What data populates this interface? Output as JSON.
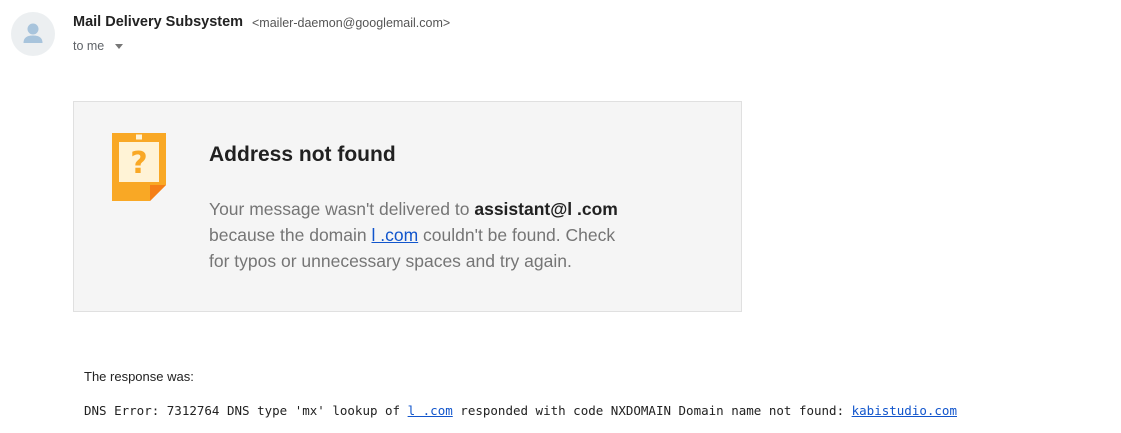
{
  "sender": {
    "name": "Mail Delivery Subsystem",
    "email": "<mailer-daemon@googlemail.com>",
    "to_label": "to me"
  },
  "icons": {
    "avatar": "person-icon",
    "dropdown": "chevron-down-icon",
    "warning": "question-note-icon"
  },
  "colors": {
    "warning_icon": "#f9a825",
    "link": "#1155cc",
    "card_background": "#f5f5f5"
  },
  "card": {
    "title": "Address not found",
    "line1_prefix": "Your message wasn't delivered to ",
    "recipient": "assistant@l          .com",
    "line2_prefix": "because the domain ",
    "domain_link": "l         .com",
    "line2_suffix": " couldn't be found. Check",
    "line3": "for typos or unnecessary spaces and try again."
  },
  "response": {
    "label": "The response was:",
    "dns_prefix": "DNS Error: 7312764 DNS type 'mx' lookup of ",
    "dns_link1": "l        .com",
    "dns_middle": " responded with code NXDOMAIN Domain name not found: ",
    "dns_link2": "kabistudio.com"
  }
}
